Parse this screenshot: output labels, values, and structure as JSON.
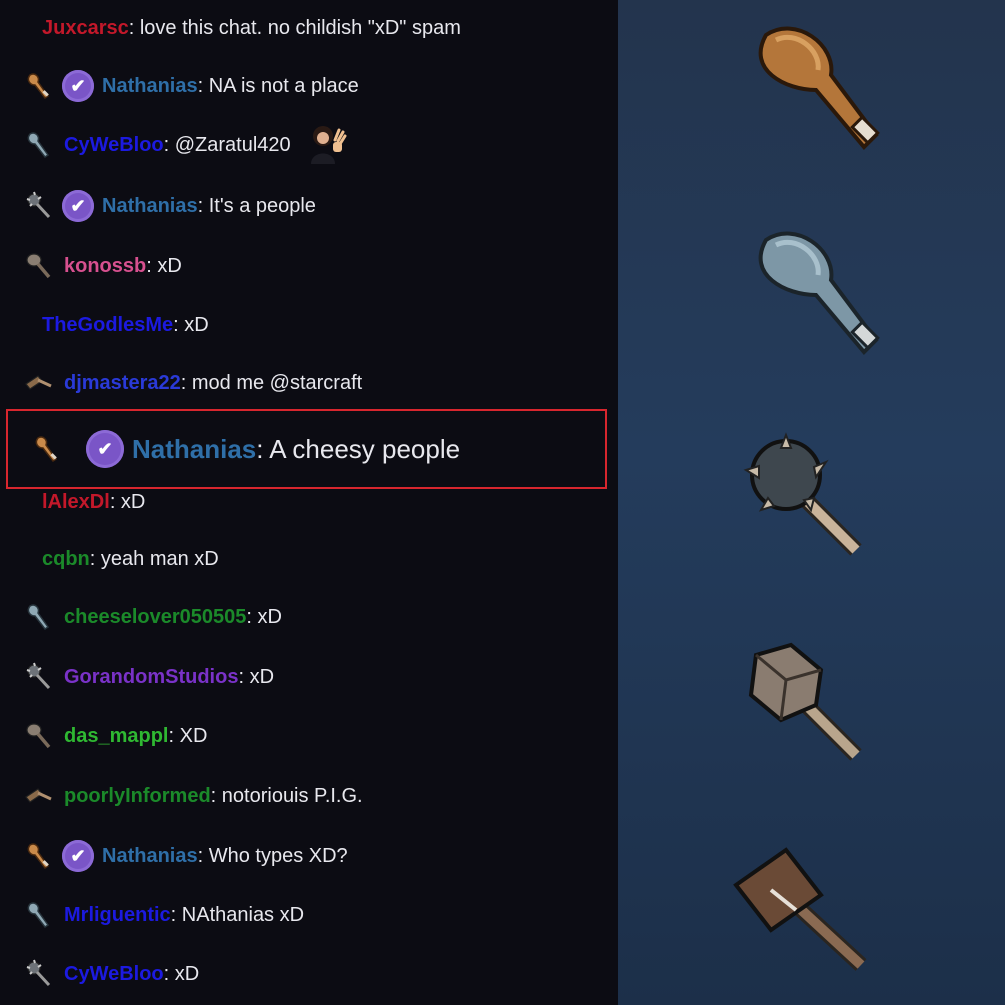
{
  "chat": {
    "messages": [
      {
        "user": "Juxcarsc",
        "text": ": love this chat. no childish \"xD\" spam",
        "color": "#c3182a",
        "badge": "none",
        "verified": false,
        "emote": false
      },
      {
        "user": "Nathanias",
        "text": ": NA is not a place",
        "color": "#2f6fa8",
        "badge": "club-icon",
        "verified": true,
        "emote": false
      },
      {
        "user": "CyWeBloo",
        "text": ": @Zaratul420",
        "color": "#1c1ae0",
        "badge": "blue-club-icon",
        "verified": false,
        "emote": true
      },
      {
        "user": "Nathanias",
        "text": ": It's a people",
        "color": "#2f6fa8",
        "badge": "spiked-club-icon",
        "verified": true,
        "emote": false
      },
      {
        "user": "konossb",
        "text": ": xD",
        "color": "#d7508f",
        "badge": "mace-icon",
        "verified": false,
        "emote": false
      },
      {
        "user": "TheGodlesMe",
        "text": ": xD",
        "color": "#1c1ae0",
        "badge": "none",
        "verified": false,
        "emote": false
      },
      {
        "user": "djmastera22",
        "text": ": mod me @starcraft",
        "color": "#2a3ad8",
        "badge": "hammer-icon",
        "verified": false,
        "emote": false
      },
      {
        "user": "Nathanias",
        "text": ": A cheesy people",
        "color": "#2f6fa8",
        "badge": "club-icon",
        "verified": true,
        "emote": false,
        "highlighted": true
      },
      {
        "user": "lAlexDl",
        "text": ": xD",
        "color": "#c3182a",
        "badge": "none",
        "verified": false,
        "emote": false
      },
      {
        "user": "cqbn",
        "text": ": yeah man xD",
        "color": "#1b8a2a",
        "badge": "none",
        "verified": false,
        "emote": false
      },
      {
        "user": "cheeselover050505",
        "text": ": xD",
        "color": "#1b8a2a",
        "badge": "blue-club-icon",
        "verified": false,
        "emote": false
      },
      {
        "user": "GorandomStudios",
        "text": ": xD",
        "color": "#7a32c8",
        "badge": "spiked-club-icon",
        "verified": false,
        "emote": false
      },
      {
        "user": "das_mappl",
        "text": ": XD",
        "color": "#2fb832",
        "badge": "mace-icon",
        "verified": false,
        "emote": false
      },
      {
        "user": "poorlyInformed",
        "text": ": notoriouis P.I.G.",
        "color": "#1b8a2a",
        "badge": "hammer-icon",
        "verified": false,
        "emote": false
      },
      {
        "user": "Nathanias",
        "text": ": Who types XD?",
        "color": "#2f6fa8",
        "badge": "club-icon",
        "verified": true,
        "emote": false
      },
      {
        "user": "Mrliguentic",
        "text": ": NAthanias xD",
        "color": "#1c1ae0",
        "badge": "blue-club-icon",
        "verified": false,
        "emote": false
      },
      {
        "user": "CyWeBloo",
        "text": ": xD",
        "color": "#1c1ae0",
        "badge": "spiked-club-icon",
        "verified": false,
        "emote": false
      }
    ]
  },
  "weapons": [
    "wooden-club-icon",
    "stone-club-icon",
    "spiked-mace-icon",
    "flanged-mace-icon",
    "war-hammer-icon"
  ]
}
